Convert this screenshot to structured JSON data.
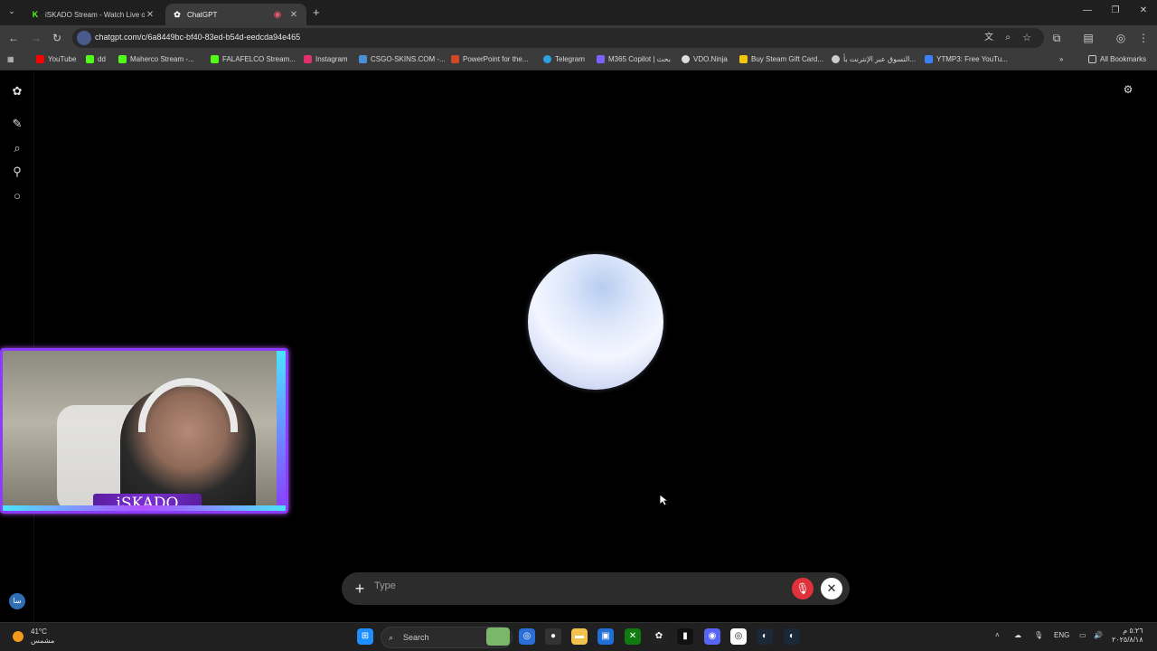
{
  "tabs": [
    {
      "title": "iSKADO Stream - Watch Live on",
      "favicon": "kick-icon",
      "active": false
    },
    {
      "title": "ChatGPT",
      "favicon": "chatgpt-icon",
      "active": true
    }
  ],
  "address": {
    "url": "chatgpt.com/c/6a8449bc-bf40-83ed-b54d-eedcda94e465"
  },
  "bookmarks": [
    {
      "label": "YouTube",
      "color": "#ff0000"
    },
    {
      "label": "dd",
      "color": "#53fc18"
    },
    {
      "label": "Maherco Stream -...",
      "color": "#53fc18"
    },
    {
      "label": "FALAFELCO Stream...",
      "color": "#53fc18"
    },
    {
      "label": "Instagram",
      "color": "#e1306c"
    },
    {
      "label": "CSGO-SKINS.COM -...",
      "color": "#4a90d9"
    },
    {
      "label": "PowerPoint for the...",
      "color": "#d24726"
    },
    {
      "label": "Telegram",
      "color": "#2aa3e0"
    },
    {
      "label": "M365 Copilot | بحث",
      "color": "#7b61ff"
    },
    {
      "label": "VDO.Ninja",
      "color": "#dddddd"
    },
    {
      "label": "Buy Steam Gift Card...",
      "color": "#f1c40f"
    },
    {
      "label": "التسوق عبر الإنترنت بأ...",
      "color": "#cccccc"
    },
    {
      "label": "YTMP3: Free YouTu...",
      "color": "#3b82f6"
    }
  ],
  "all_bookmarks_label": "All Bookmarks",
  "voice": {
    "placeholder": "Type"
  },
  "webcam": {
    "name": "iSKADO"
  },
  "user": {
    "avatar_text": "سا"
  },
  "taskbar": {
    "weather_temp": "41°C",
    "weather_desc": "مشمس",
    "search_label": "Search",
    "lang": "ENG",
    "time": "٥:٢٦ م",
    "date": "٢٠٢٥/٨/١٨"
  }
}
